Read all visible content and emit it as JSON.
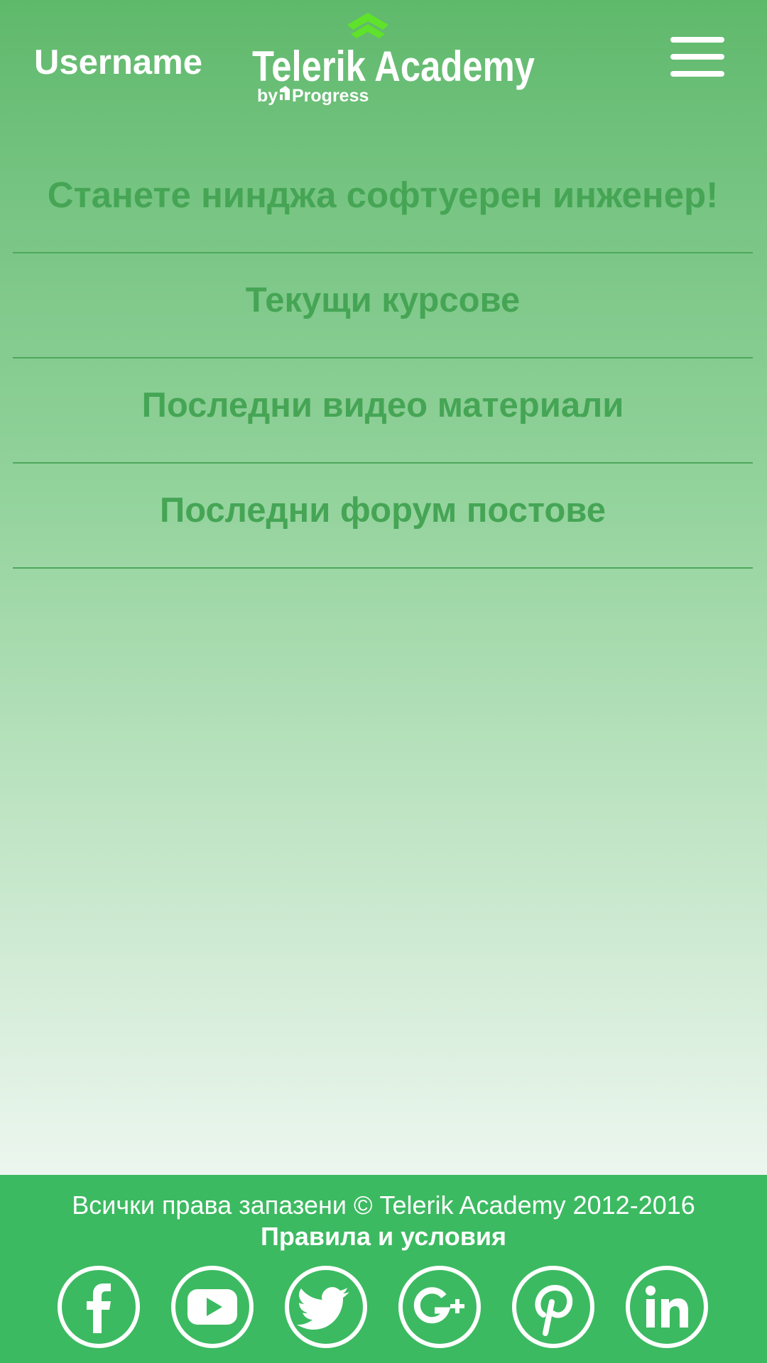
{
  "header": {
    "username": "Username",
    "logo": {
      "brand": "Telerik Academy",
      "byline": "by",
      "parent_brand": "Progress"
    },
    "menu_icon": "hamburger-menu-icon"
  },
  "nav": {
    "tagline": "Станете нинджа софтуерен инженер!",
    "items": [
      {
        "label": "Текущи курсове"
      },
      {
        "label": "Последни видео материали"
      },
      {
        "label": "Последни форум постове"
      }
    ]
  },
  "footer": {
    "copyright": "Всички права запазени © Telerik Academy 2012-2016",
    "terms_link": "Правила и условия",
    "social_icons": [
      "facebook-icon",
      "youtube-icon",
      "twitter-icon",
      "google-plus-icon",
      "pinterest-icon",
      "linkedin-icon"
    ]
  },
  "colors": {
    "footer_bg": "#3cba61",
    "nav_text": "#45a555",
    "logo_chevron": "#5fe22a",
    "white": "#ffffff"
  }
}
